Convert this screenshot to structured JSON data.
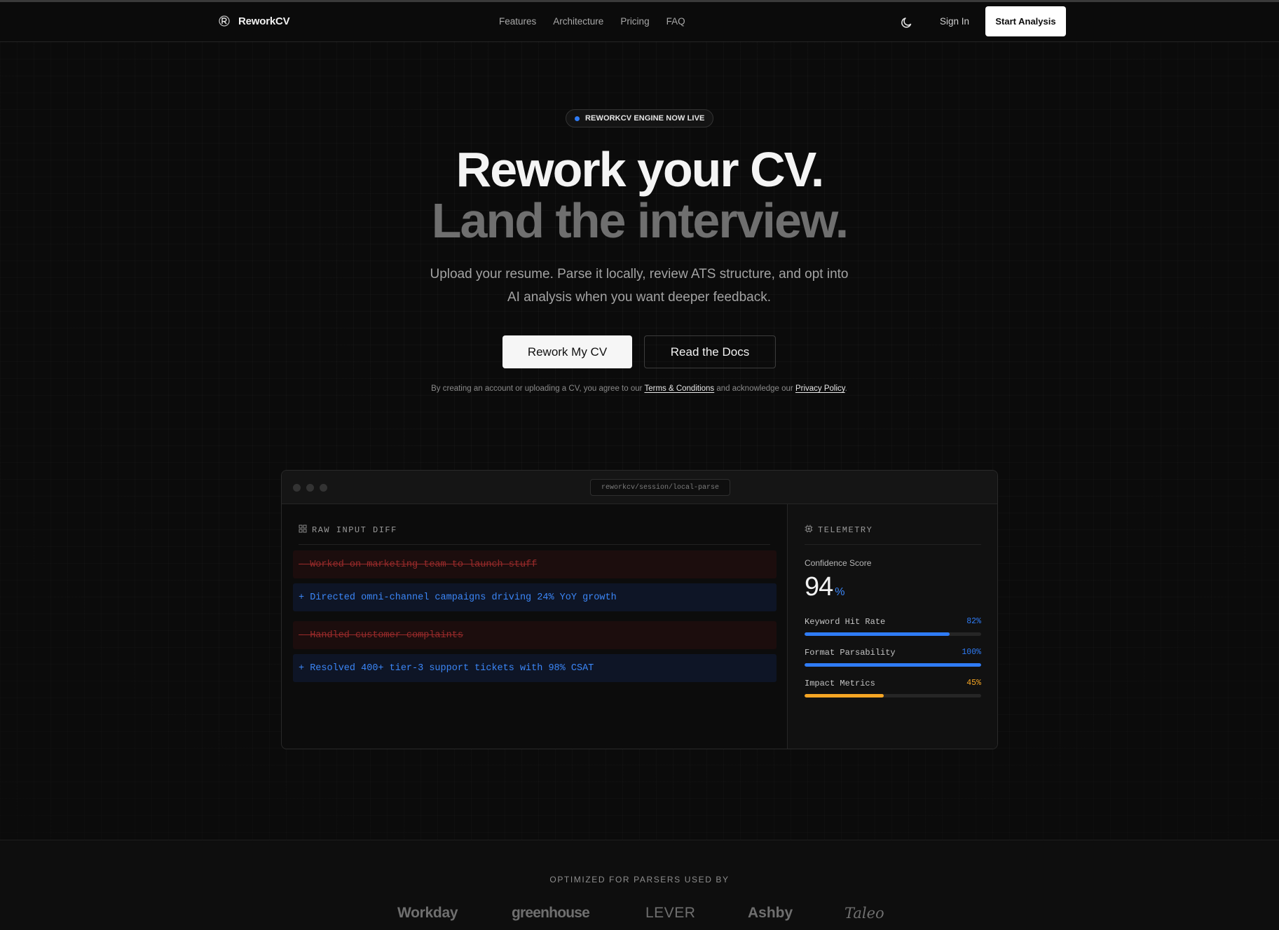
{
  "nav": {
    "brand": "ReworkCV",
    "links": [
      "Features",
      "Architecture",
      "Pricing",
      "FAQ"
    ],
    "sign_in": "Sign In",
    "start": "Start Analysis"
  },
  "hero": {
    "badge": "REWORKCV ENGINE NOW LIVE",
    "title_line1": "Rework your CV.",
    "title_line2": "Land the interview.",
    "subtitle": "Upload your resume. Parse it locally, review ATS structure, and opt into AI analysis when you want deeper feedback.",
    "primary_button": "Rework My CV",
    "secondary_button": "Read the Docs",
    "legal_prefix": "By creating an account or uploading a CV, you agree to our",
    "terms": "Terms & Conditions",
    "legal_middle": "and acknowledge our",
    "privacy": "Privacy Policy",
    "legal_suffix": "."
  },
  "window": {
    "url": "reworkcv/session/local-parse",
    "diff_title": "RAW INPUT DIFF",
    "diff_lines": [
      {
        "type": "del",
        "text": "- Worked on marketing team to launch stuff"
      },
      {
        "type": "add",
        "text": "+ Directed omni-channel campaigns driving 24% YoY growth"
      },
      {
        "type": "del",
        "text": "- Handled customer complaints"
      },
      {
        "type": "add",
        "text": "+ Resolved 400+ tier-3 support tickets with 98% CSAT"
      }
    ],
    "telemetry_title": "TELEMETRY",
    "confidence_label": "Confidence Score",
    "confidence_value": "94",
    "confidence_unit": "%",
    "metrics": [
      {
        "label": "Keyword Hit Rate",
        "value": "82%",
        "fraction": 0.82,
        "color": "#2f7cf6"
      },
      {
        "label": "Format Parsability",
        "value": "100%",
        "fraction": 1.0,
        "color": "#2f7cf6"
      },
      {
        "label": "Impact Metrics",
        "value": "45%",
        "fraction": 0.45,
        "color": "#f5a524"
      }
    ]
  },
  "parsers": {
    "label": "OPTIMIZED FOR PARSERS USED BY",
    "logos": [
      "Workday",
      "greenhouse",
      "LEVER",
      "Ashby",
      "Taleo"
    ]
  },
  "colors": {
    "accent": "#2f7cf6",
    "warning": "#f5a524",
    "deleted": "#9a2a2a",
    "background": "#0b0b0b"
  }
}
